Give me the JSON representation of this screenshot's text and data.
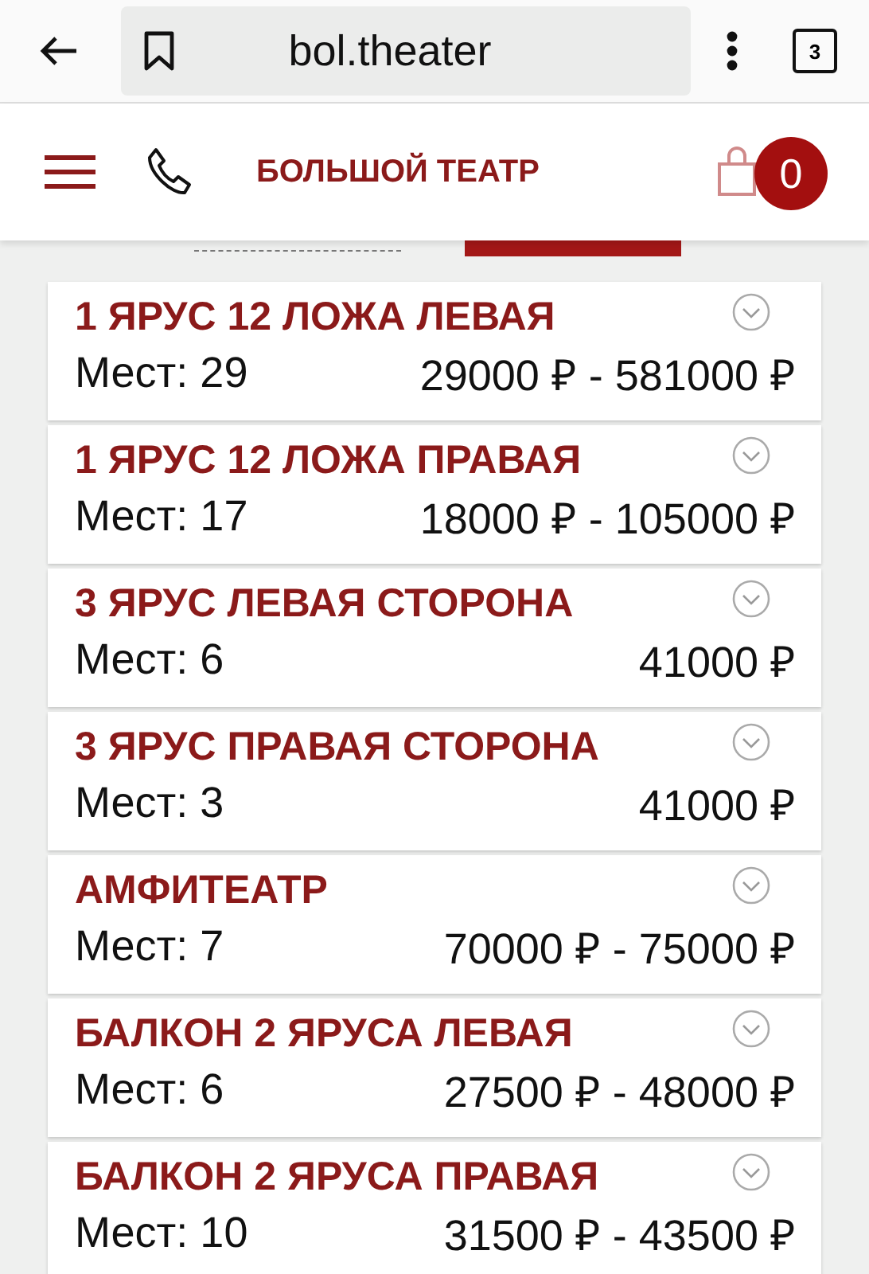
{
  "browser": {
    "url": "bol.theater",
    "tab_count": "3"
  },
  "header": {
    "title": "БОЛЬШОЙ ТЕАТР",
    "cart_count": "0"
  },
  "view_tabs": [
    {
      "selected": false
    },
    {
      "selected": true
    }
  ],
  "sections": [
    {
      "name": "1 ЯРУС 12 ЛОЖА ЛЕВАЯ",
      "seats": "Мест: 29",
      "price": "29000 ₽ - 581000 ₽",
      "expanded": false
    },
    {
      "name": "1 ЯРУС 12 ЛОЖА ПРАВАЯ",
      "seats": "Мест: 17",
      "price": "18000 ₽ - 105000 ₽",
      "expanded": false
    },
    {
      "name": "3 ЯРУС ЛЕВАЯ СТОРОНА",
      "seats": "Мест: 6",
      "price": "41000 ₽",
      "expanded": false
    },
    {
      "name": "3 ЯРУС ПРАВАЯ СТОРОНА",
      "seats": "Мест: 3",
      "price": "41000 ₽",
      "expanded": false
    },
    {
      "name": "АМФИТЕАТР",
      "seats": "Мест: 7",
      "price": "70000 ₽ - 75000 ₽",
      "expanded": false
    },
    {
      "name": "БАЛКОН 2 ЯРУСА ЛЕВАЯ",
      "seats": "Мест: 6",
      "price": "27500 ₽ - 48000 ₽",
      "expanded": false
    },
    {
      "name": "БАЛКОН 2 ЯРУСА ПРАВАЯ",
      "seats": "Мест: 10",
      "price": "31500 ₽ - 43500 ₽",
      "expanded": false
    }
  ]
}
